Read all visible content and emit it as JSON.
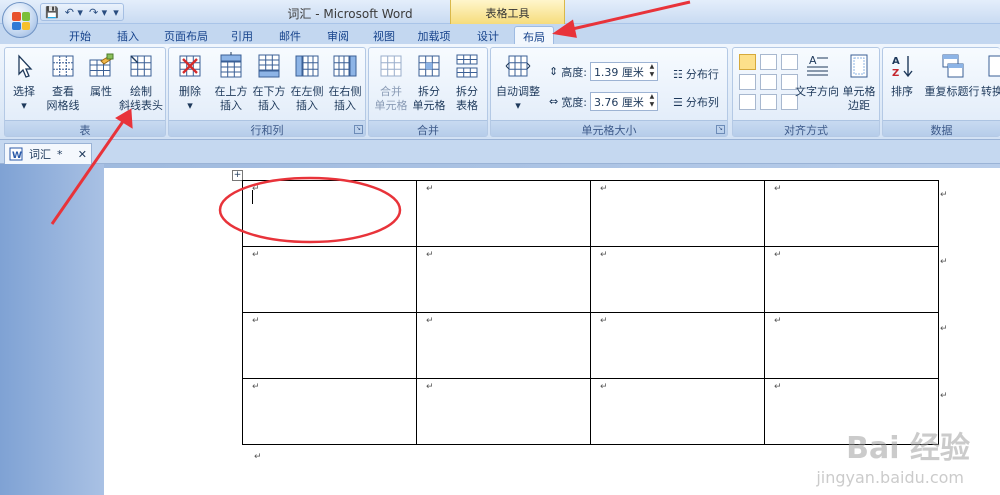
{
  "window": {
    "title": "词汇 - Microsoft Word",
    "context_label": "表格工具"
  },
  "qat": {
    "save": "💾",
    "undo": "↶ ▾",
    "redo": "↷ ▾",
    "more": "▾"
  },
  "tabs": [
    "开始",
    "插入",
    "页面布局",
    "引用",
    "邮件",
    "审阅",
    "视图",
    "加载项",
    "设计",
    "布局"
  ],
  "active_tab": "布局",
  "ribbon": {
    "table_group": {
      "label": "表",
      "buttons": [
        {
          "name": "select-button",
          "label": "选择",
          "sub": "▾"
        },
        {
          "name": "view-gridlines-button",
          "label": "查看",
          "sub": "网格线"
        },
        {
          "name": "properties-button",
          "label": "属性",
          "sub": ""
        },
        {
          "name": "draw-diagonal-header-button",
          "label": "绘制",
          "sub": "斜线表头"
        }
      ]
    },
    "rows_cols_group": {
      "label": "行和列",
      "buttons": [
        {
          "name": "delete-button",
          "label": "删除",
          "sub": "▾"
        },
        {
          "name": "insert-above-button",
          "label": "在上方",
          "sub": "插入"
        },
        {
          "name": "insert-below-button",
          "label": "在下方",
          "sub": "插入"
        },
        {
          "name": "insert-left-button",
          "label": "在左侧",
          "sub": "插入"
        },
        {
          "name": "insert-right-button",
          "label": "在右侧",
          "sub": "插入"
        }
      ]
    },
    "merge_group": {
      "label": "合并",
      "buttons": [
        {
          "name": "merge-cells-button",
          "label": "合并",
          "sub": "单元格"
        },
        {
          "name": "split-cells-button",
          "label": "拆分",
          "sub": "单元格"
        },
        {
          "name": "split-table-button",
          "label": "拆分",
          "sub": "表格"
        }
      ]
    },
    "cell_size_group": {
      "label": "单元格大小",
      "autofit_label": "自动调整",
      "autofit_sub": "▾",
      "height_label": "高度:",
      "height_value": "1.39 厘米",
      "width_label": "宽度:",
      "width_value": "3.76 厘米",
      "distribute_rows": "分布行",
      "distribute_cols": "分布列"
    },
    "alignment_group": {
      "label": "对齐方式",
      "text_direction_label": "文字方向",
      "cell_margins_label": "单元格",
      "cell_margins_sub": "边距"
    },
    "data_group": {
      "label": "数据",
      "sort_label": "排序",
      "repeat_header_label": "重复标题行",
      "convert_label": "转换"
    }
  },
  "document_tab": {
    "label": "词汇",
    "modified": "*",
    "close": "✕"
  },
  "table": {
    "rows": 4,
    "cols": 4,
    "cell_mark": "↵",
    "handle": "+"
  },
  "watermark": {
    "main": "Bai 经验",
    "sub": "jingyan.baidu.com"
  },
  "colors": {
    "annotation_red": "#e8333a",
    "ribbon_bg": "#dde9f7",
    "context_tab": "#f6dc7c"
  }
}
